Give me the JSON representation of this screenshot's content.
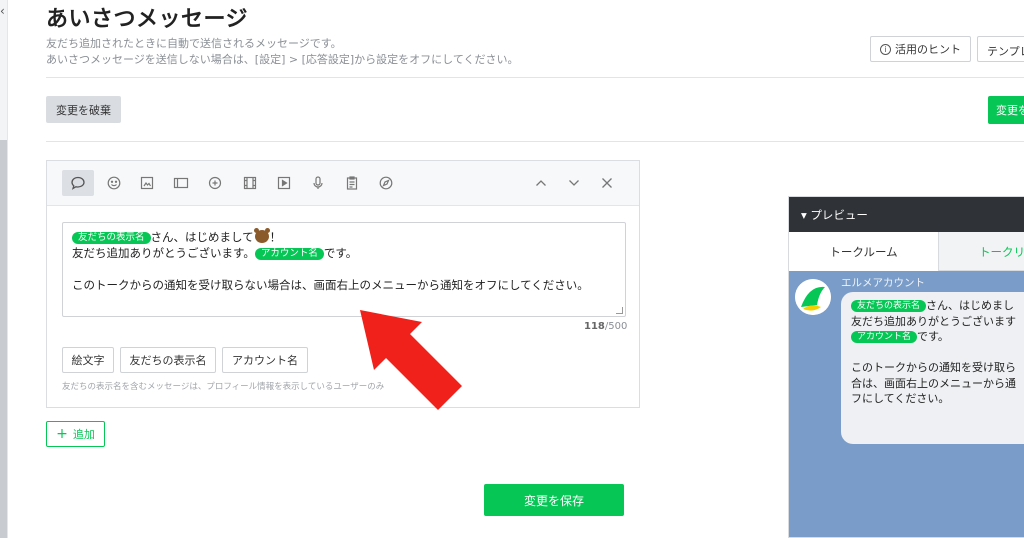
{
  "page": {
    "title": "あいさつメッセージ",
    "description_line1": "友だち追加されたときに自動で送信されるメッセージです。",
    "description_line2": "あいさつメッセージを送信しない場合は、[設定] > [応答設定]から設定をオフにしてください。",
    "hint_label": "活用のヒント",
    "template_label": "テンプレ",
    "discard_label": "変更を破棄",
    "save_top_label": "変更を",
    "save_label": "変更を保存",
    "add_label": "追加"
  },
  "editor": {
    "toolbar_icons": [
      "speech-bubble-icon",
      "emoji-icon",
      "image-icon",
      "rich-card-icon",
      "sticker-icon",
      "video-icon",
      "play-icon",
      "microphone-icon",
      "clipboard-icon",
      "compass-icon"
    ],
    "nav_icons": [
      "chevron-up-icon",
      "chevron-down-icon",
      "close-icon"
    ],
    "message": {
      "tag_display_name": "友だちの表示名",
      "line1_text": "さん、はじめまして",
      "line1_end": "！",
      "line2_start": "友だち追加ありがとうございます。",
      "tag_account_name": "アカウント名",
      "line2_end": "です。",
      "line3": "このトークからの通知を受け取らない場合は、画面右上のメニューから通知をオフにしてください。"
    },
    "counter_current": "118",
    "counter_max": "/500",
    "chips": [
      "絵文字",
      "友だちの表示名",
      "アカウント名"
    ],
    "note": "友だちの表示名を含むメッセージは、プロフィール情報を表示しているユーザーのみ"
  },
  "preview": {
    "header": "▾ プレビュー",
    "tab_talkroom": "トークルーム",
    "tab_talklist": "トークリ",
    "account_name": "エルメアカウント",
    "bubble": {
      "tag_display_name": "友だちの表示名",
      "line1_text": "さん、はじめまし",
      "line2": "友だち追加ありがとうございます",
      "tag_account_name": "アカウント名",
      "line3_end": "です。",
      "line5": "このトークからの通知を受け取ら",
      "line6": "合は、画面右上のメニューから通",
      "line7": "フにしてください。"
    }
  },
  "colors": {
    "accent_green": "#06c755",
    "annotation_red": "#f0211a",
    "preview_chat_bg": "#7a9cc8"
  }
}
